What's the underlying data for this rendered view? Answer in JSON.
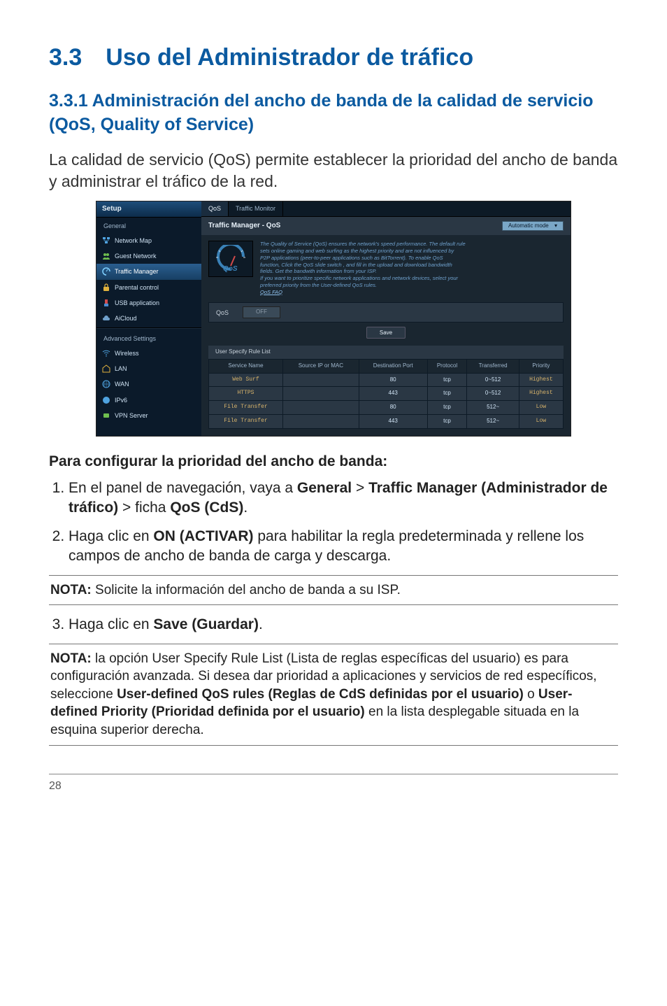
{
  "heading": "3.3 Uso del Administrador de tráfico",
  "subheading": "3.3.1 Administración del ancho de banda de la calidad de servicio (QoS, Quality of Service)",
  "intro": "La calidad de servicio (QoS) permite establecer la prioridad del ancho de banda y administrar el tráfico de la red.",
  "screenshot": {
    "setup_label": "Setup",
    "group_general": "General",
    "nav": {
      "network_map": "Network Map",
      "guest_network": "Guest Network",
      "traffic_manager": "Traffic Manager",
      "parental_control": "Parental control",
      "usb_application": "USB application",
      "aicloud": "AiCloud"
    },
    "group_advanced": "Advanced Settings",
    "adv": {
      "wireless": "Wireless",
      "lan": "LAN",
      "wan": "WAN",
      "ipv6": "IPv6",
      "vpn_server": "VPN Server"
    },
    "tabs": {
      "qos": "QoS",
      "traffic_monitor": "Traffic Monitor"
    },
    "panel_title": "Traffic Manager - QoS",
    "mode": "Automatic mode",
    "desc_lines": [
      "The Quality of Service (QoS) ensures the network's speed performance. The default rule",
      "sets online gaming and web surfing as the highest priority and are not influenced by",
      "P2P applications (peer-to-peer applications such as BitTorrent). To enable QoS",
      "function, Click the QoS slide switch , and fill in the upload and download bandwidth",
      "fields. Get the bandwith information from your ISP.",
      "If you want to prioritize specific network applications and network devices, select your",
      "preferred priority from the User-defined QoS rules."
    ],
    "faq_link": "QoS FAQ",
    "toggle_label": "QoS",
    "toggle_value": "OFF",
    "save_btn": "Save",
    "rule_head": "User Specify Rule List",
    "table": {
      "headers": [
        "Service Name",
        "Source IP or MAC",
        "Destination Port",
        "Protocol",
        "Transferred",
        "Priority"
      ],
      "rows": [
        {
          "service": "Web Surf",
          "src": "",
          "port": "80",
          "proto": "tcp",
          "trans": "0~512",
          "prio": "Highest"
        },
        {
          "service": "HTTPS",
          "src": "",
          "port": "443",
          "proto": "tcp",
          "trans": "0~512",
          "prio": "Highest"
        },
        {
          "service": "File Transfer",
          "src": "",
          "port": "80",
          "proto": "tcp",
          "trans": "512~",
          "prio": "Low"
        },
        {
          "service": "File Transfer",
          "src": "",
          "port": "443",
          "proto": "tcp",
          "trans": "512~",
          "prio": "Low"
        }
      ]
    }
  },
  "config_head": "Para configurar la prioridad del ancho de banda:",
  "steps": {
    "s1a": "En el panel de navegación, vaya a ",
    "s1b": "General",
    "s1c": " > ",
    "s1d": "Traffic Manager (Administrador de tráfico)",
    "s1e": " > ficha ",
    "s1f": "QoS (CdS)",
    "s1g": ".",
    "s2a": "Haga clic en ",
    "s2b": "ON (ACTIVAR)",
    "s2c": " para habilitar la regla predeterminada y rellene los campos de ancho de banda de carga y descarga.",
    "s3a": "Haga clic en ",
    "s3b": "Save (Guardar)",
    "s3c": "."
  },
  "note1_label": "NOTA:",
  "note1_text": " Solicite la información del ancho de banda a su ISP.",
  "note2_label": "NOTA:",
  "note2_a": "  la opción User Specify Rule List (Lista de reglas específicas del usuario) es para configuración avanzada. Si desea dar prioridad a aplicaciones y servicios de red específicos, seleccione ",
  "note2_b": "User-defined QoS rules (Reglas de CdS definidas por el usuario)",
  "note2_c": " o ",
  "note2_d": "User-defined Priority (Prioridad definida por el usuario)",
  "note2_e": " en la lista desplegable situada en la esquina superior derecha.",
  "page_number": "28"
}
